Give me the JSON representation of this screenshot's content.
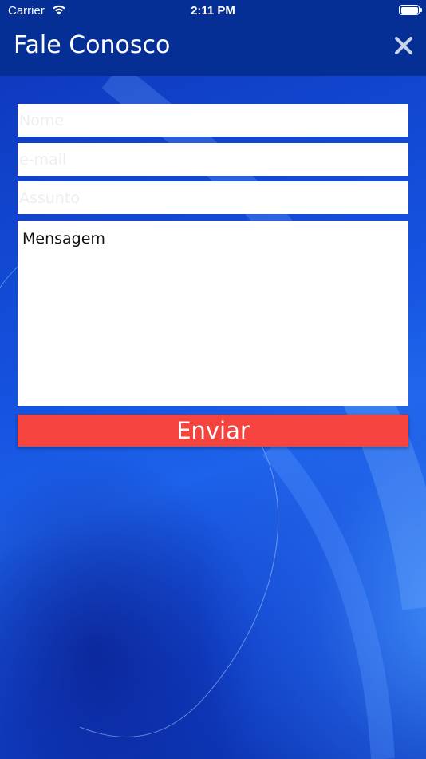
{
  "status_bar": {
    "carrier": "Carrier",
    "time": "2:11 PM",
    "wifi_icon": "wifi-icon",
    "battery_icon": "battery-icon",
    "battery_level": 1.0
  },
  "nav": {
    "title": "Fale Conosco",
    "close_icon": "close-icon"
  },
  "form": {
    "nome": {
      "placeholder": "Nome",
      "value": ""
    },
    "email": {
      "placeholder": "e-mail",
      "value": ""
    },
    "assunto": {
      "placeholder": "Assunto",
      "value": ""
    },
    "mensagem": {
      "placeholder": "Mensagem",
      "value": ""
    },
    "submit_label": "Enviar"
  },
  "colors": {
    "header_bg": "#062f96",
    "button_bg": "#f5433d",
    "background_accent": "#1553e0"
  }
}
